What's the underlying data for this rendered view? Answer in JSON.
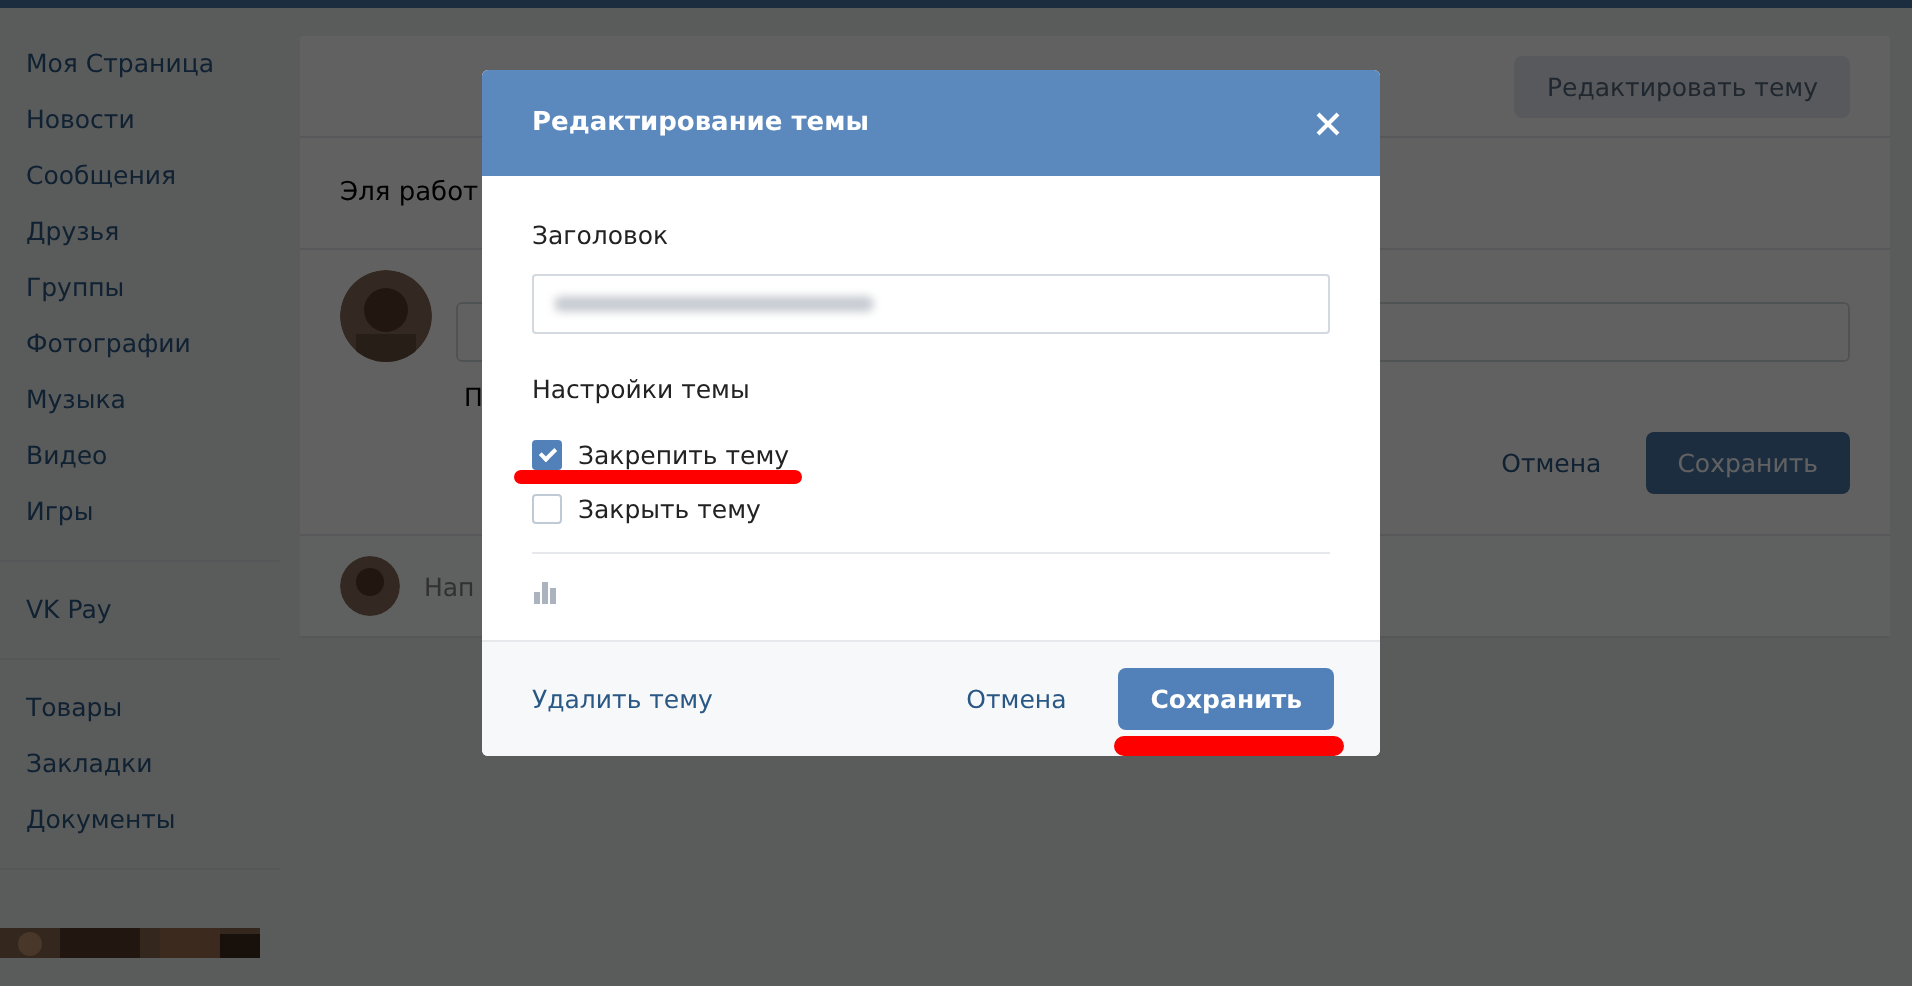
{
  "sidebar": {
    "sections": [
      {
        "items": [
          {
            "label": "Моя Страница"
          },
          {
            "label": "Новости"
          },
          {
            "label": "Сообщения"
          },
          {
            "label": "Друзья"
          },
          {
            "label": "Группы"
          },
          {
            "label": "Фотографии"
          },
          {
            "label": "Музыка"
          },
          {
            "label": "Видео"
          },
          {
            "label": "Игры"
          }
        ]
      },
      {
        "items": [
          {
            "label": "VK Pay"
          }
        ]
      },
      {
        "items": [
          {
            "label": "Товары"
          },
          {
            "label": "Закладки"
          },
          {
            "label": "Документы"
          }
        ]
      }
    ]
  },
  "page": {
    "edit_button": "Редактировать тему",
    "topic_title": "Эля работ",
    "post_text": "П",
    "reply_placeholder": "Нап",
    "cancel": "Отмена",
    "save": "Сохранить"
  },
  "modal": {
    "title": "Редактирование темы",
    "field_label": "Заголовок",
    "settings_label": "Настройки темы",
    "options": [
      {
        "label": "Закрепить тему",
        "checked": true,
        "underlined": true
      },
      {
        "label": "Закрыть тему",
        "checked": false,
        "underlined": false
      }
    ],
    "footer": {
      "delete": "Удалить тему",
      "cancel": "Отмена",
      "save": "Сохранить",
      "save_underlined": true
    }
  }
}
